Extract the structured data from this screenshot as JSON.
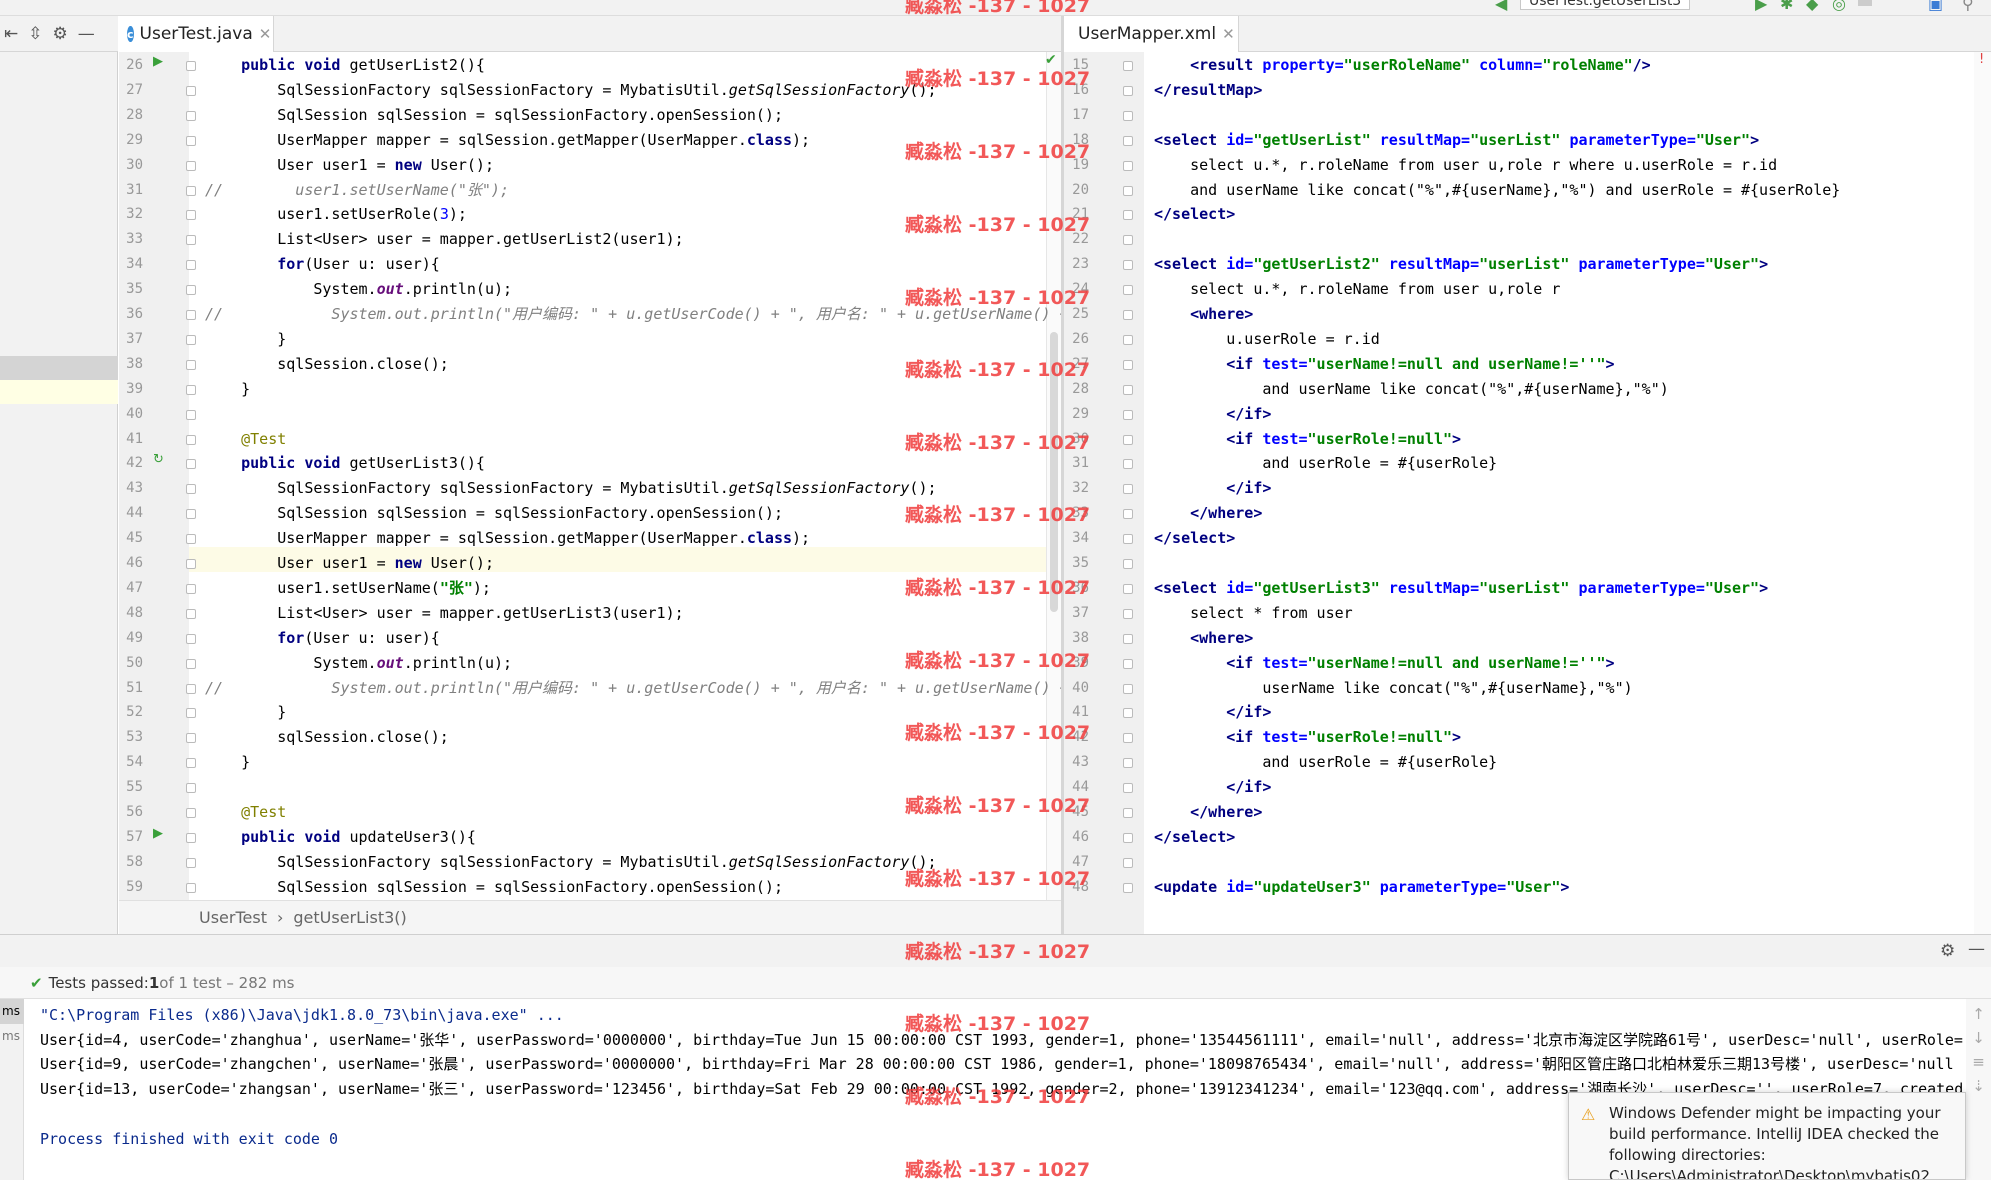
{
  "watermark": "臧淼松 -137 - 1027",
  "left_tab": {
    "title": "UserTest.java"
  },
  "right_tab": {
    "title": "UserMapper.xml"
  },
  "run_config": "UserTest.getUserList3",
  "breadcrumb": {
    "class_name": "UserTest",
    "method_name": "getUserList3()"
  },
  "left_code": [
    {
      "n": "26",
      "t": [
        [
          "    ",
          ""
        ],
        [
          "public void ",
          "kw"
        ],
        [
          "getUserList2(){",
          ""
        ]
      ]
    },
    {
      "n": "27",
      "t": [
        [
          "        SqlSessionFactory sqlSessionFactory = MybatisUtil.",
          ""
        ],
        [
          "getSqlSessionFactory",
          "it"
        ],
        [
          "();",
          ""
        ]
      ]
    },
    {
      "n": "28",
      "t": [
        [
          "        SqlSession sqlSession = sqlSessionFactory.openSession();",
          ""
        ]
      ]
    },
    {
      "n": "29",
      "t": [
        [
          "        UserMapper mapper = sqlSession.getMapper(UserMapper.",
          ""
        ],
        [
          "class",
          "kw"
        ],
        [
          ");",
          ""
        ]
      ]
    },
    {
      "n": "30",
      "t": [
        [
          "        User user1 = ",
          ""
        ],
        [
          "new ",
          "kw"
        ],
        [
          "User();",
          ""
        ]
      ]
    },
    {
      "n": "31",
      "t": [
        [
          "//        user1.setUserName(\"张\");",
          "cm"
        ]
      ]
    },
    {
      "n": "32",
      "t": [
        [
          "        user1.setUserRole(",
          ""
        ],
        [
          "3",
          "num"
        ],
        [
          ");",
          ""
        ]
      ]
    },
    {
      "n": "33",
      "t": [
        [
          "        List<User> user = mapper.getUserList2(user1);",
          ""
        ]
      ]
    },
    {
      "n": "34",
      "t": [
        [
          "        ",
          ""
        ],
        [
          "for",
          "kw"
        ],
        [
          "(User u: user){",
          ""
        ]
      ]
    },
    {
      "n": "35",
      "t": [
        [
          "            System.",
          ""
        ],
        [
          "out",
          "fld"
        ],
        [
          ".println(u);",
          ""
        ]
      ]
    },
    {
      "n": "36",
      "t": [
        [
          "//            System.out.println(\"用户编码: \" + u.getUserCode() + \", 用户名: \" + u.getUserName() + ",
          "cm"
        ]
      ]
    },
    {
      "n": "37",
      "t": [
        [
          "        }",
          ""
        ]
      ]
    },
    {
      "n": "38",
      "t": [
        [
          "        sqlSession.close();",
          ""
        ]
      ]
    },
    {
      "n": "39",
      "t": [
        [
          "    }",
          ""
        ]
      ]
    },
    {
      "n": "40",
      "t": [
        [
          "",
          ""
        ]
      ]
    },
    {
      "n": "41",
      "t": [
        [
          "    @Test",
          "an"
        ]
      ]
    },
    {
      "n": "42",
      "t": [
        [
          "    ",
          ""
        ],
        [
          "public void ",
          "kw"
        ],
        [
          "getUserList3(){",
          ""
        ]
      ]
    },
    {
      "n": "43",
      "t": [
        [
          "        SqlSessionFactory sqlSessionFactory = MybatisUtil.",
          ""
        ],
        [
          "getSqlSessionFactory",
          "it"
        ],
        [
          "();",
          ""
        ]
      ]
    },
    {
      "n": "44",
      "t": [
        [
          "        SqlSession sqlSession = sqlSessionFactory.openSession();",
          ""
        ]
      ]
    },
    {
      "n": "45",
      "t": [
        [
          "        UserMapper mapper = sqlSession.getMapper(UserMapper.",
          ""
        ],
        [
          "class",
          "kw"
        ],
        [
          ");",
          ""
        ]
      ]
    },
    {
      "n": "46",
      "t": [
        [
          "        User user1 = ",
          ""
        ],
        [
          "new ",
          "kw"
        ],
        [
          "User();",
          ""
        ]
      ]
    },
    {
      "n": "47",
      "t": [
        [
          "        user1.setUserName(",
          ""
        ],
        [
          "\"张\"",
          "str"
        ],
        [
          ");",
          ""
        ]
      ]
    },
    {
      "n": "48",
      "t": [
        [
          "        List<User> user = mapper.getUserList3(user1);",
          ""
        ]
      ]
    },
    {
      "n": "49",
      "t": [
        [
          "        ",
          ""
        ],
        [
          "for",
          "kw"
        ],
        [
          "(User u: user){",
          ""
        ]
      ]
    },
    {
      "n": "50",
      "t": [
        [
          "            System.",
          ""
        ],
        [
          "out",
          "fld"
        ],
        [
          ".println(u);",
          ""
        ]
      ]
    },
    {
      "n": "51",
      "t": [
        [
          "//            System.out.println(\"用户编码: \" + u.getUserCode() + \", 用户名: \" + u.getUserName() + ",
          "cm"
        ]
      ]
    },
    {
      "n": "52",
      "t": [
        [
          "        }",
          ""
        ]
      ]
    },
    {
      "n": "53",
      "t": [
        [
          "        sqlSession.close();",
          ""
        ]
      ]
    },
    {
      "n": "54",
      "t": [
        [
          "    }",
          ""
        ]
      ]
    },
    {
      "n": "55",
      "t": [
        [
          "",
          ""
        ]
      ]
    },
    {
      "n": "56",
      "t": [
        [
          "    @Test",
          "an"
        ]
      ]
    },
    {
      "n": "57",
      "t": [
        [
          "    ",
          ""
        ],
        [
          "public void ",
          "kw"
        ],
        [
          "updateUser3(){",
          ""
        ]
      ]
    },
    {
      "n": "58",
      "t": [
        [
          "        SqlSessionFactory sqlSessionFactory = MybatisUtil.",
          ""
        ],
        [
          "getSqlSessionFactory",
          "it"
        ],
        [
          "();",
          ""
        ]
      ]
    },
    {
      "n": "59",
      "t": [
        [
          "        SqlSession sqlSession = sqlSessionFactory.openSession();",
          ""
        ]
      ]
    }
  ],
  "right_code": [
    {
      "n": "15",
      "t": [
        [
          "    ",
          ""
        ],
        [
          "<result ",
          "tag"
        ],
        [
          "property=",
          "atn"
        ],
        [
          "\"userRoleName\" ",
          "atv"
        ],
        [
          "column=",
          "atn"
        ],
        [
          "\"roleName\"",
          "atv"
        ],
        [
          "/>",
          "tag"
        ]
      ]
    },
    {
      "n": "16",
      "t": [
        [
          "</resultMap>",
          "tag"
        ]
      ]
    },
    {
      "n": "17",
      "t": [
        [
          "",
          ""
        ]
      ]
    },
    {
      "n": "18",
      "t": [
        [
          "<select ",
          "tag"
        ],
        [
          "id=",
          "atn"
        ],
        [
          "\"getUserList\" ",
          "atv"
        ],
        [
          "resultMap=",
          "atn"
        ],
        [
          "\"userList\" ",
          "atv"
        ],
        [
          "parameterType=",
          "atn"
        ],
        [
          "\"User\"",
          "atv"
        ],
        [
          ">",
          "tag"
        ]
      ]
    },
    {
      "n": "19",
      "t": [
        [
          "    select u.*, r.roleName from user u,role r where u.userRole = r.id",
          ""
        ]
      ]
    },
    {
      "n": "20",
      "t": [
        [
          "    and userName like concat(\"%\",#{userName},\"%\") and userRole = #{userRole}",
          ""
        ]
      ]
    },
    {
      "n": "21",
      "t": [
        [
          "</select>",
          "tag"
        ]
      ]
    },
    {
      "n": "22",
      "t": [
        [
          "",
          ""
        ]
      ]
    },
    {
      "n": "23",
      "t": [
        [
          "<select ",
          "tag"
        ],
        [
          "id=",
          "atn"
        ],
        [
          "\"getUserList2\" ",
          "atv"
        ],
        [
          "resultMap=",
          "atn"
        ],
        [
          "\"userList\" ",
          "atv"
        ],
        [
          "parameterType=",
          "atn"
        ],
        [
          "\"User\"",
          "atv"
        ],
        [
          ">",
          "tag"
        ]
      ]
    },
    {
      "n": "24",
      "t": [
        [
          "    select u.*, r.roleName from user u,role r",
          ""
        ]
      ]
    },
    {
      "n": "25",
      "t": [
        [
          "    ",
          ""
        ],
        [
          "<where>",
          "tag"
        ]
      ]
    },
    {
      "n": "26",
      "t": [
        [
          "        u.userRole = r.id",
          ""
        ]
      ]
    },
    {
      "n": "27",
      "t": [
        [
          "        ",
          ""
        ],
        [
          "<if ",
          "tag"
        ],
        [
          "test=",
          "atn"
        ],
        [
          "\"userName!=null and userName!=''\"",
          "atv"
        ],
        [
          ">",
          "tag"
        ]
      ]
    },
    {
      "n": "28",
      "t": [
        [
          "            and userName like concat(\"%\",#{userName},\"%\")",
          ""
        ]
      ]
    },
    {
      "n": "29",
      "t": [
        [
          "        ",
          ""
        ],
        [
          "</if>",
          "tag"
        ]
      ]
    },
    {
      "n": "30",
      "t": [
        [
          "        ",
          ""
        ],
        [
          "<if ",
          "tag"
        ],
        [
          "test=",
          "atn"
        ],
        [
          "\"userRole!=null\"",
          "atv"
        ],
        [
          ">",
          "tag"
        ]
      ]
    },
    {
      "n": "31",
      "t": [
        [
          "            and userRole = #{userRole}",
          ""
        ]
      ]
    },
    {
      "n": "32",
      "t": [
        [
          "        ",
          ""
        ],
        [
          "</if>",
          "tag"
        ]
      ]
    },
    {
      "n": "33",
      "t": [
        [
          "    ",
          ""
        ],
        [
          "</where>",
          "tag"
        ]
      ]
    },
    {
      "n": "34",
      "t": [
        [
          "</select>",
          "tag"
        ]
      ]
    },
    {
      "n": "35",
      "t": [
        [
          "",
          ""
        ]
      ]
    },
    {
      "n": "36",
      "t": [
        [
          "<select ",
          "tag"
        ],
        [
          "id=",
          "atn"
        ],
        [
          "\"getUserList3\" ",
          "atv"
        ],
        [
          "resultMap=",
          "atn"
        ],
        [
          "\"userList\" ",
          "atv"
        ],
        [
          "parameterType=",
          "atn"
        ],
        [
          "\"User\"",
          "atv"
        ],
        [
          ">",
          "tag"
        ]
      ]
    },
    {
      "n": "37",
      "t": [
        [
          "    select * from user",
          ""
        ]
      ]
    },
    {
      "n": "38",
      "t": [
        [
          "    ",
          ""
        ],
        [
          "<where>",
          "tag"
        ]
      ]
    },
    {
      "n": "39",
      "t": [
        [
          "        ",
          ""
        ],
        [
          "<if ",
          "tag"
        ],
        [
          "test=",
          "atn"
        ],
        [
          "\"userName!=null and userName!=''\"",
          "atv"
        ],
        [
          ">",
          "tag"
        ]
      ]
    },
    {
      "n": "40",
      "t": [
        [
          "            userName like concat(\"%\",#{userName},\"%\")",
          ""
        ]
      ]
    },
    {
      "n": "41",
      "t": [
        [
          "        ",
          ""
        ],
        [
          "</if>",
          "tag"
        ]
      ]
    },
    {
      "n": "42",
      "t": [
        [
          "        ",
          ""
        ],
        [
          "<if ",
          "tag"
        ],
        [
          "test=",
          "atn"
        ],
        [
          "\"userRole!=null\"",
          "atv"
        ],
        [
          ">",
          "tag"
        ]
      ]
    },
    {
      "n": "43",
      "t": [
        [
          "            and userRole = #{userRole}",
          ""
        ]
      ]
    },
    {
      "n": "44",
      "t": [
        [
          "        ",
          ""
        ],
        [
          "</if>",
          "tag"
        ]
      ]
    },
    {
      "n": "45",
      "t": [
        [
          "    ",
          ""
        ],
        [
          "</where>",
          "tag"
        ]
      ]
    },
    {
      "n": "46",
      "t": [
        [
          "</select>",
          "tag"
        ]
      ]
    },
    {
      "n": "47",
      "t": [
        [
          "",
          ""
        ]
      ]
    },
    {
      "n": "48",
      "t": [
        [
          "<update ",
          "tag"
        ],
        [
          "id=",
          "atn"
        ],
        [
          "\"updateUser3\" ",
          "atv"
        ],
        [
          "parameterType=",
          "atn"
        ],
        [
          "\"User\"",
          "atv"
        ],
        [
          ">",
          "tag"
        ]
      ]
    }
  ],
  "run": {
    "status_prefix": "Tests passed: ",
    "passed": "1",
    "status_suffix": " of 1 test – 282 ms",
    "side_label_1": "ms",
    "side_label_2": "ms",
    "lines": [
      "\"C:\\Program Files (x86)\\Java\\jdk1.8.0_73\\bin\\java.exe\" ...",
      "User{id=4, userCode='zhanghua', userName='张华', userPassword='0000000', birthday=Tue Jun 15 00:00:00 CST 1993, gender=1, phone='13544561111', email='null', address='北京市海淀区学院路61号', userDesc='null', userRole=",
      "User{id=9, userCode='zhangchen', userName='张晨', userPassword='0000000', birthday=Fri Mar 28 00:00:00 CST 1986, gender=1, phone='18098765434', email='null', address='朝阳区管庄路口北柏林爱乐三期13号楼', userDesc='null",
      "User{id=13, userCode='zhangsan', userName='张三', userPassword='123456', birthday=Sat Feb 29 00:00:00 CST 1992, gender=2, phone='13912341234', email='123@qq.com', address='湖南长沙', userDesc='', userRole=7, created",
      "",
      "Process finished with exit code 0"
    ]
  },
  "notification": {
    "text": "Windows Defender might be impacting your build performance. IntelliJ IDEA checked the following directories:",
    "path": "C:\\Users\\Administrator\\Desktop\\mybatis02"
  }
}
